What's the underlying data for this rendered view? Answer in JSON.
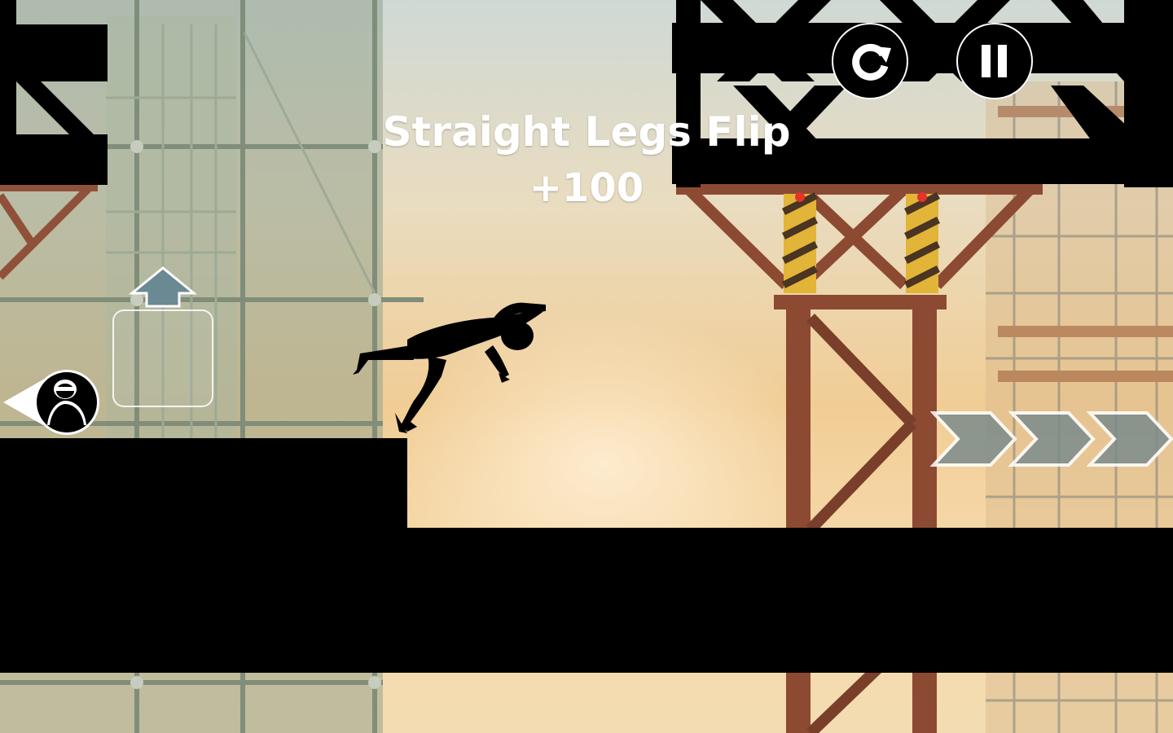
{
  "hud": {
    "restart_icon": "restart-icon",
    "pause_icon": "pause-icon"
  },
  "trick": {
    "name": "Straight Legs Flip",
    "points": "+100"
  },
  "controls": {
    "jump_arrow_icon": "up-arrow-icon",
    "hunter_marker_icon": "hunter-indicator-icon",
    "speed_arrows_icon": "chevron-right-icon"
  },
  "colors": {
    "silhouette": "#000000",
    "text": "#ffffff",
    "steel": "#8c4a33",
    "scaffold": "#6f7f6a",
    "hazard_yellow": "#e2b437"
  }
}
